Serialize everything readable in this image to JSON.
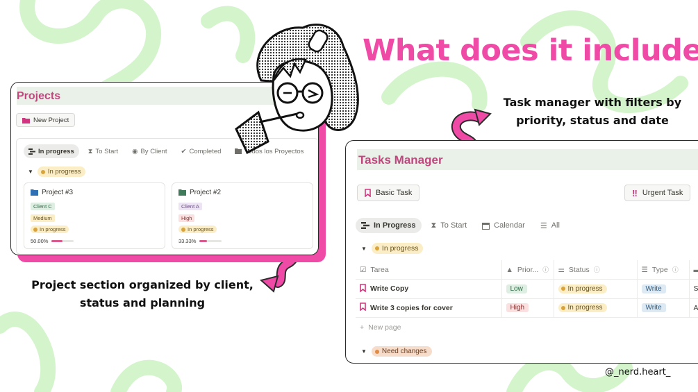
{
  "headline": "What does it include?",
  "captions": {
    "tasks": "Task manager with filters by priority, status and date",
    "projects": "Project section organized by client, status and planning"
  },
  "handle": "@_nerd.heart_",
  "colors": {
    "accent": "#ef4aa6",
    "title": "#c2467d",
    "swirl": "#cdf5c7"
  },
  "projects": {
    "title": "Projects",
    "new_button": "New Project",
    "views": [
      {
        "label": "In progress",
        "icon": "stack-icon",
        "active": true
      },
      {
        "label": "To Start",
        "icon": "hourglass-icon",
        "active": false
      },
      {
        "label": "By Client",
        "icon": "person-icon",
        "active": false
      },
      {
        "label": "Completed",
        "icon": "check-circle-icon",
        "active": false
      },
      {
        "label": "Todos los Proyectos",
        "icon": "folder-icon",
        "active": false
      }
    ],
    "group": "In progress",
    "cards": [
      {
        "title": "Project #3",
        "client": "Client C",
        "priority": "Medium",
        "status": "In progress",
        "progress_label": "50.00%",
        "progress": 0.5
      },
      {
        "title": "Project #2",
        "client": "Client A",
        "priority": "High",
        "status": "In progress",
        "progress_label": "33.33%",
        "progress": 0.3333
      }
    ]
  },
  "tasks": {
    "title": "Tasks Manager",
    "basic_button": "Basic Task",
    "urgent_button": "Urgent Task",
    "views": [
      {
        "label": "In Progress",
        "icon": "stack-icon",
        "active": true
      },
      {
        "label": "To Start",
        "icon": "hourglass-icon",
        "active": false
      },
      {
        "label": "Calendar",
        "icon": "calendar-icon",
        "active": false
      },
      {
        "label": "All",
        "icon": "list-icon",
        "active": false
      }
    ],
    "group1": "In progress",
    "columns": {
      "task": "Tarea",
      "priority": "Prior...",
      "status": "Status",
      "type": "Type"
    },
    "rows": [
      {
        "task": "Write Copy",
        "priority": "Low",
        "status": "In progress",
        "type": "Write",
        "extra": "Se"
      },
      {
        "task": "Write 3 copies for cover",
        "priority": "High",
        "status": "In progress",
        "type": "Write",
        "extra": "Au"
      }
    ],
    "new_page": "New page",
    "group2": "Need changes"
  }
}
